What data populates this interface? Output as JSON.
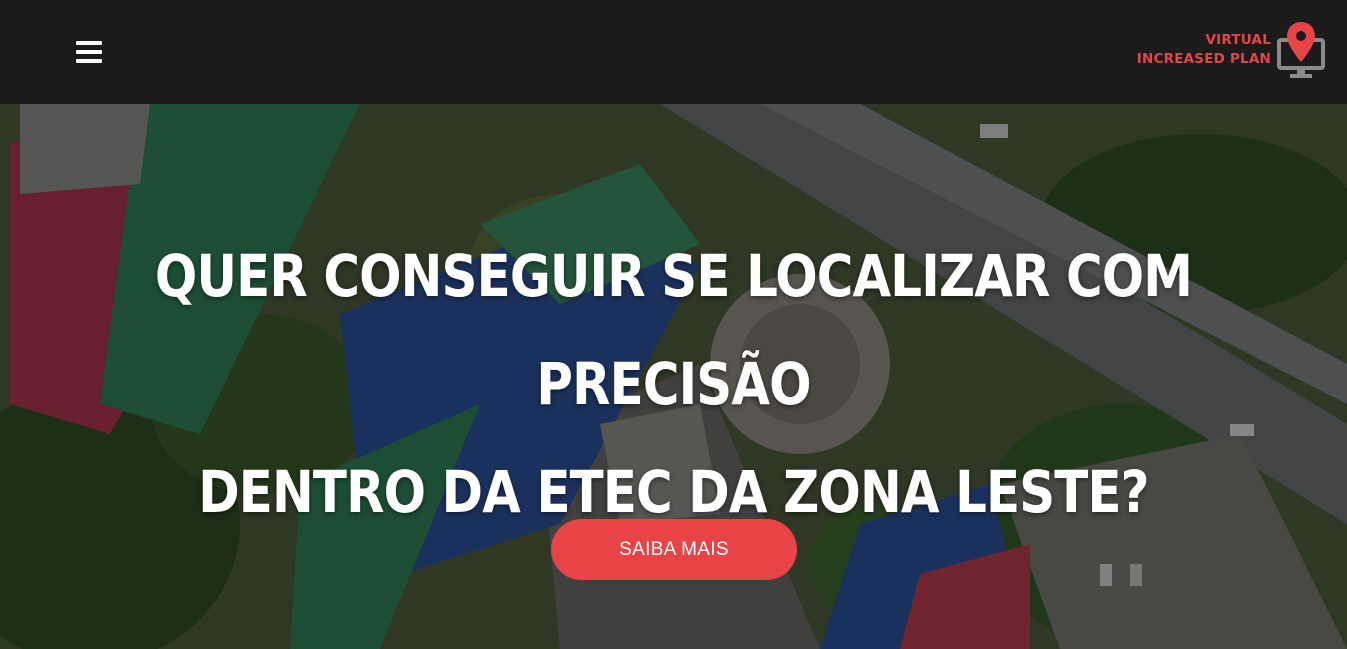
{
  "nav": {
    "menu_icon": "hamburger-menu-icon",
    "brand": {
      "line1": "VIRTUAL",
      "line2": "INCREASED PLAN",
      "logo_icon": "map-pin-monitor-icon",
      "color": "#e84447"
    }
  },
  "hero": {
    "headline_line1": "QUER CONSEGUIR SE LOCALIZAR COM PRECISÃO",
    "headline_line2": "DENTRO DA ETEC DA ZONA LESTE?",
    "cta_label": "SAIBA MAIS",
    "cta_color": "#e84447",
    "background": "aerial-campus-photo"
  }
}
